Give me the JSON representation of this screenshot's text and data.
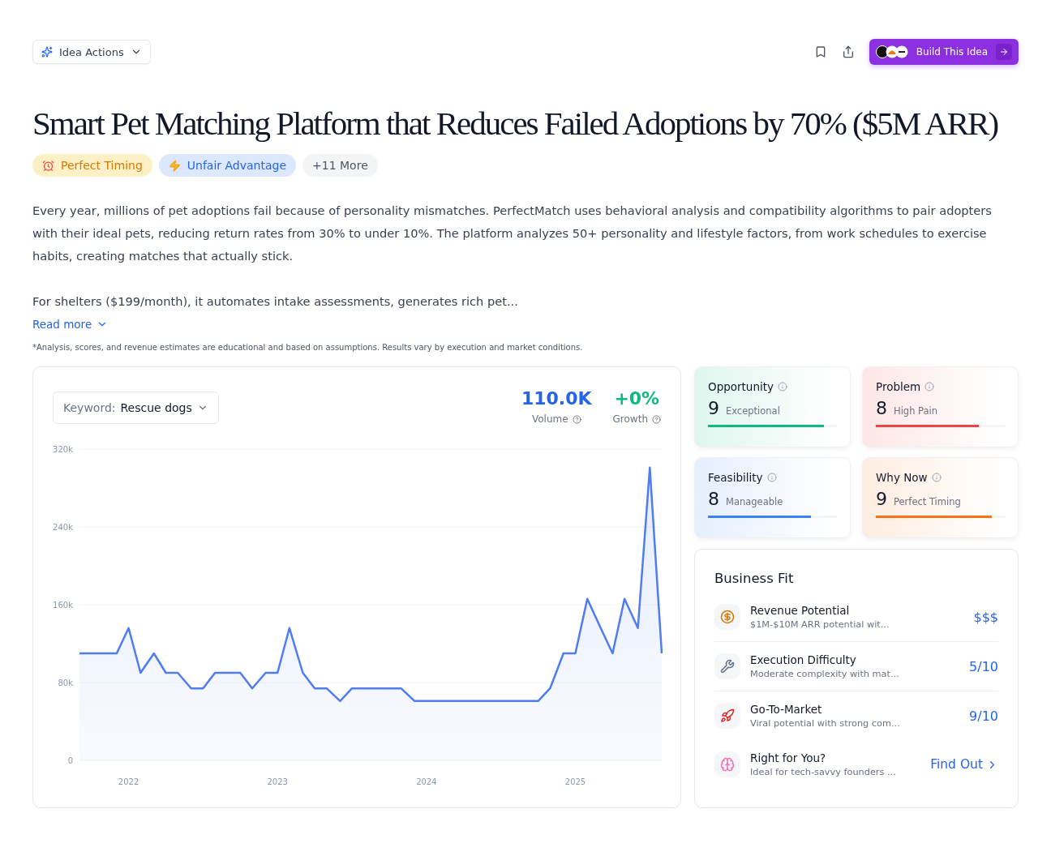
{
  "toolbar": {
    "actions_menu": "Idea Actions",
    "build_button": "Build This Idea"
  },
  "title": "Smart Pet Matching Platform that Reduces Failed Adoptions by 70% ($5M ARR)",
  "tags": [
    {
      "kind": "timing",
      "label": "Perfect Timing"
    },
    {
      "kind": "advantage",
      "label": "Unfair Advantage"
    },
    {
      "kind": "more",
      "label": "+11 More"
    }
  ],
  "description": [
    "Every year, millions of pet adoptions fail because of personality mismatches. PerfectMatch uses behavioral analysis and compatibility algorithms to pair adopters with their ideal pets, reducing return rates from 30% to under 10%. The platform analyzes 50+ personality and lifestyle factors, from work schedules to exercise habits, creating matches that actually stick.",
    "For shelters ($199/month), it automates intake assessments, generates rich pet..."
  ],
  "read_more": "Read more",
  "disclaimer": "*Analysis, scores, and revenue estimates are educational and based on assumptions. Results vary by execution and market conditions.",
  "trend": {
    "keyword_label": "Keyword:",
    "keyword": "Rescue dogs",
    "volume": "110.0K",
    "volume_label": "Volume",
    "growth": "+0%",
    "growth_label": "Growth",
    "chart_data": {
      "type": "area",
      "x": [
        2021.67,
        2021.75,
        2021.83,
        2021.92,
        2022.0,
        2022.08,
        2022.17,
        2022.25,
        2022.33,
        2022.42,
        2022.5,
        2022.58,
        2022.67,
        2022.75,
        2022.83,
        2022.92,
        2023.0,
        2023.08,
        2023.17,
        2023.25,
        2023.33,
        2023.42,
        2023.5,
        2023.58,
        2023.67,
        2023.75,
        2023.83,
        2023.92,
        2024.0,
        2024.08,
        2024.17,
        2024.25,
        2024.33,
        2024.42,
        2024.5,
        2024.58,
        2024.67,
        2024.75,
        2024.83,
        2024.92,
        2025.0,
        2025.08,
        2025.17,
        2025.25,
        2025.33,
        2025.42,
        2025.5,
        2025.58
      ],
      "series": [
        {
          "color": "#4f7cf0",
          "values": [
            110000,
            110000,
            110000,
            110000,
            136000,
            90000,
            110000,
            90000,
            90000,
            74000,
            74000,
            90000,
            90000,
            90000,
            74000,
            90000,
            90000,
            136000,
            90000,
            74000,
            74000,
            61000,
            74000,
            74000,
            74000,
            74000,
            74000,
            61000,
            61000,
            61000,
            61000,
            61000,
            61000,
            61000,
            61000,
            61000,
            61000,
            61000,
            74000,
            110000,
            110000,
            166000,
            136000,
            110000,
            166000,
            136000,
            301000,
            110000
          ]
        }
      ],
      "ylim": [
        0,
        320000
      ],
      "xlim": [
        2021.67,
        2025.58
      ],
      "yticks": [
        {
          "value": 0,
          "label": "0"
        },
        {
          "value": 80000,
          "label": "80k"
        },
        {
          "value": 160000,
          "label": "160k"
        },
        {
          "value": 240000,
          "label": "240k"
        },
        {
          "value": 320000,
          "label": "320k"
        }
      ],
      "xticks": [
        2022,
        2023,
        2024,
        2025
      ],
      "grid": true
    }
  },
  "scores": [
    {
      "title": "Opportunity",
      "score": "9",
      "rating": "Exceptional",
      "level": 0.9,
      "color": "#10b981"
    },
    {
      "title": "Problem",
      "score": "8",
      "rating": "High Pain",
      "level": 0.8,
      "color": "#ef4444"
    },
    {
      "title": "Feasibility",
      "score": "8",
      "rating": "Manageable",
      "level": 0.8,
      "color": "#3b82f6"
    },
    {
      "title": "Why Now",
      "score": "9",
      "rating": "Perfect Timing",
      "level": 0.9,
      "color": "#f97316"
    }
  ],
  "business_fit": {
    "title": "Business Fit",
    "rows": [
      {
        "kind": "revenue",
        "label": "Revenue Potential",
        "detail": "$1M-$10M ARR potential wit...",
        "value": "$$$"
      },
      {
        "kind": "execution",
        "label": "Execution Difficulty",
        "detail": "Moderate complexity with mat...",
        "value": "5/10"
      },
      {
        "kind": "market",
        "label": "Go-To-Market",
        "detail": "Viral potential with strong com...",
        "value": "9/10"
      },
      {
        "kind": "fit",
        "label": "Right for You?",
        "detail": "Ideal for tech-savvy founders ...",
        "value": "Find Out",
        "link": true
      }
    ]
  }
}
